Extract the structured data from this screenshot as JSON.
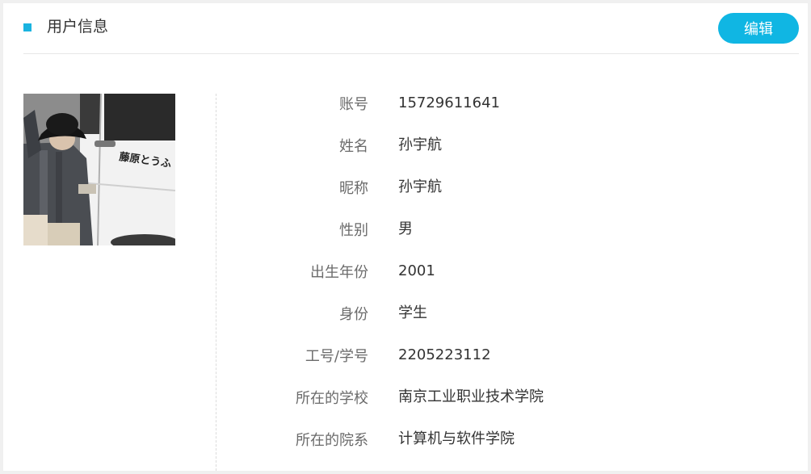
{
  "header": {
    "title": "用户信息",
    "edit_label": "编辑",
    "accent_color": "#10b6e3"
  },
  "profile": {
    "rows": [
      {
        "label": "账号",
        "value": "15729611641"
      },
      {
        "label": "姓名",
        "value": "孙宇航"
      },
      {
        "label": "昵称",
        "value": "孙宇航"
      },
      {
        "label": "性别",
        "value": "男"
      },
      {
        "label": "出生年份",
        "value": "2001"
      },
      {
        "label": "身份",
        "value": "学生"
      },
      {
        "label": "工号/学号",
        "value": "2205223112"
      },
      {
        "label": "所在的学校",
        "value": "南京工业职业技术学院"
      },
      {
        "label": "所在的院系",
        "value": "计算机与软件学院"
      }
    ]
  },
  "avatar": {
    "photo_lettering": "藤原とうふ店"
  }
}
